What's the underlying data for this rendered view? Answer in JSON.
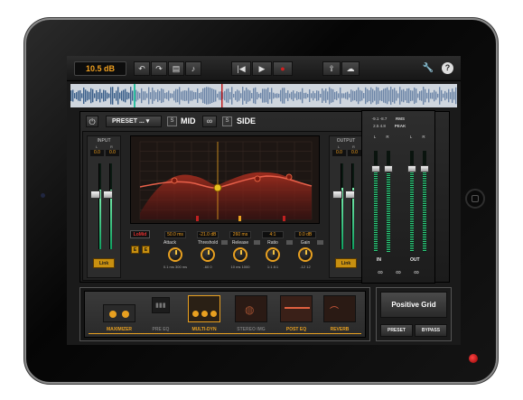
{
  "topbar": {
    "gain_readout": "10.5 dB",
    "icons": [
      "undo-icon",
      "redo-icon",
      "document-icon",
      "music-note-icon",
      "rewind-icon",
      "play-icon",
      "record-icon",
      "share-icon",
      "soundcloud-icon",
      "wrench-icon",
      "help-icon"
    ],
    "help_label": "?"
  },
  "module_header": {
    "preset_label": "PRESET ...",
    "mid_label": "MID",
    "side_label": "SIDE"
  },
  "input": {
    "label": "INPUT",
    "left_value": "0.0",
    "right_value": "0.0",
    "l": "L",
    "r": "R",
    "link_label": "Link"
  },
  "output": {
    "label": "OUTPUT",
    "left_value": "0.0",
    "right_value": "0.0",
    "l": "L",
    "r": "R",
    "link_label": "Link"
  },
  "band_selector": {
    "band_label": "LoMid",
    "buttons": [
      "E",
      "E"
    ]
  },
  "controls": [
    {
      "label": "Attack",
      "value": "50.0 ms",
      "range_min": "0.1 ms",
      "range_max": "300 ms"
    },
    {
      "label": "Threshold",
      "value": "-21.0 dB",
      "range_min": "-60",
      "range_max": "0"
    },
    {
      "label": "Release",
      "value": "260 ms",
      "range_min": "10 ms",
      "range_max": "1000"
    },
    {
      "label": "Ratio",
      "value": "4:1",
      "range_min": "1:1",
      "range_max": "8:1"
    },
    {
      "label": "Gain",
      "value": "0.0 dB",
      "range_min": "-12",
      "range_max": "12"
    }
  ],
  "meters": {
    "rms_label": "RMS",
    "peak_label": "PEAK",
    "rms_values": [
      "-9.1",
      "-8.7"
    ],
    "peak_values": [
      "2.5",
      "4.8"
    ],
    "in_label": "IN",
    "out_label": "OUT",
    "l": "L",
    "r": "R",
    "levels": {
      "in_l": 0.82,
      "in_r": 0.78,
      "out_l": 0.86,
      "out_r": 0.8
    }
  },
  "chain": [
    {
      "name": "MAXIMIZER",
      "active": true
    },
    {
      "name": "PRE EQ",
      "active": false
    },
    {
      "name": "MULTI-DYN",
      "active": true
    },
    {
      "name": "STEREO IMG",
      "active": false
    },
    {
      "name": "POST EQ",
      "active": true
    },
    {
      "name": "REVERB",
      "active": true
    }
  ],
  "brand": {
    "name": "Positive Grid",
    "preset_button": "PRESET",
    "bypass_button": "BYPASS"
  },
  "colors": {
    "accent": "#e8a020",
    "curve": "#e06040",
    "meter": "#30d080",
    "readout": "#f0a020"
  }
}
